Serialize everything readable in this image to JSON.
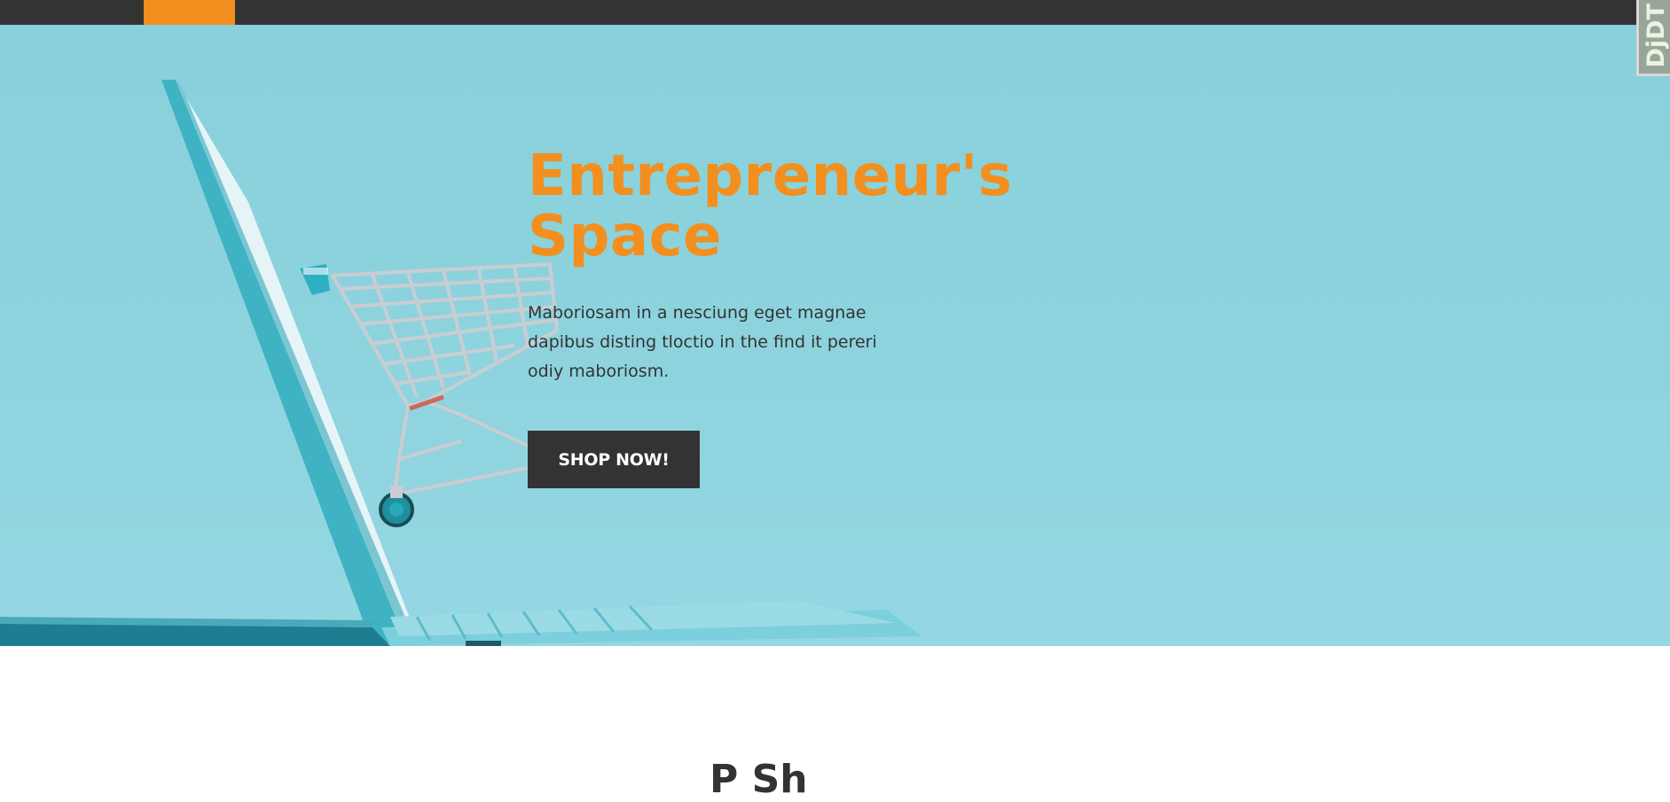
{
  "hero": {
    "title_line1": "Entrepreneur's",
    "title_line2": "Space",
    "description": "Maboriosam in a nesciung eget magnae dapibus disting tloctio in the find it pereri odiy maboriosm.",
    "button_label": "SHOP NOW!"
  },
  "debug_toolbar": {
    "label": "DjDT"
  },
  "next_section": {
    "heading_partial": "P    Sh"
  },
  "colors": {
    "accent": "#f28f1f",
    "dark": "#333333",
    "hero_bg": "#8dd3de"
  }
}
